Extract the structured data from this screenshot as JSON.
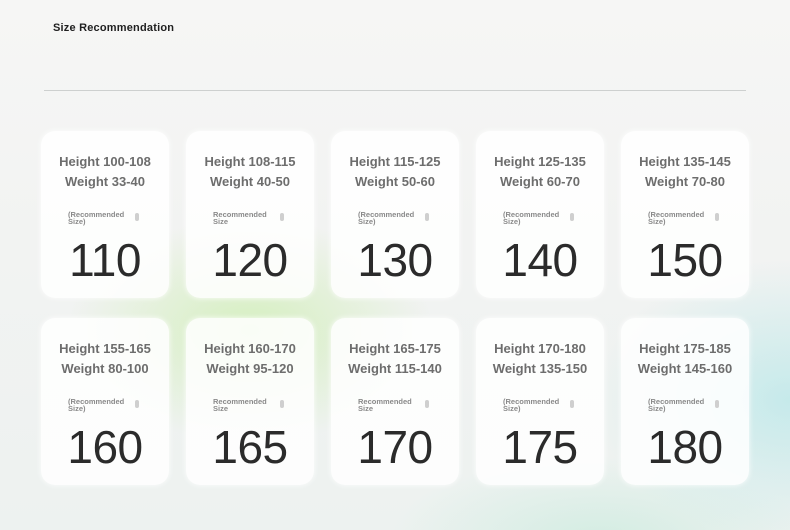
{
  "page": {
    "title": "Size Recommendation"
  },
  "cards": [
    {
      "height": "Height 100-108",
      "weight": "Weight 33-40",
      "label": "(Recommended Size)",
      "size": "110"
    },
    {
      "height": "Height 108-115",
      "weight": "Weight 40-50",
      "label": "Recommended Size",
      "size": "120"
    },
    {
      "height": "Height 115-125",
      "weight": "Weight 50-60",
      "label": "(Recommended Size)",
      "size": "130"
    },
    {
      "height": "Height 125-135",
      "weight": "Weight 60-70",
      "label": "(Recommended Size)",
      "size": "140"
    },
    {
      "height": "Height 135-145",
      "weight": "Weight 70-80",
      "label": "(Recommended Size)",
      "size": "150"
    },
    {
      "height": "Height 155-165",
      "weight": "Weight 80-100",
      "label": "(Recommended Size)",
      "size": "160"
    },
    {
      "height": "Height 160-170",
      "weight": "Weight 95-120",
      "label": "Recommended Size",
      "size": "165"
    },
    {
      "height": "Height 165-175",
      "weight": "Weight 115-140",
      "label": "Recommended Size",
      "size": "170"
    },
    {
      "height": "Height 170-180",
      "weight": "Weight 135-150",
      "label": "(Recommended Size)",
      "size": "175"
    },
    {
      "height": "Height 175-185",
      "weight": "Weight 145-160",
      "label": "(Recommended Size)",
      "size": "180"
    }
  ]
}
